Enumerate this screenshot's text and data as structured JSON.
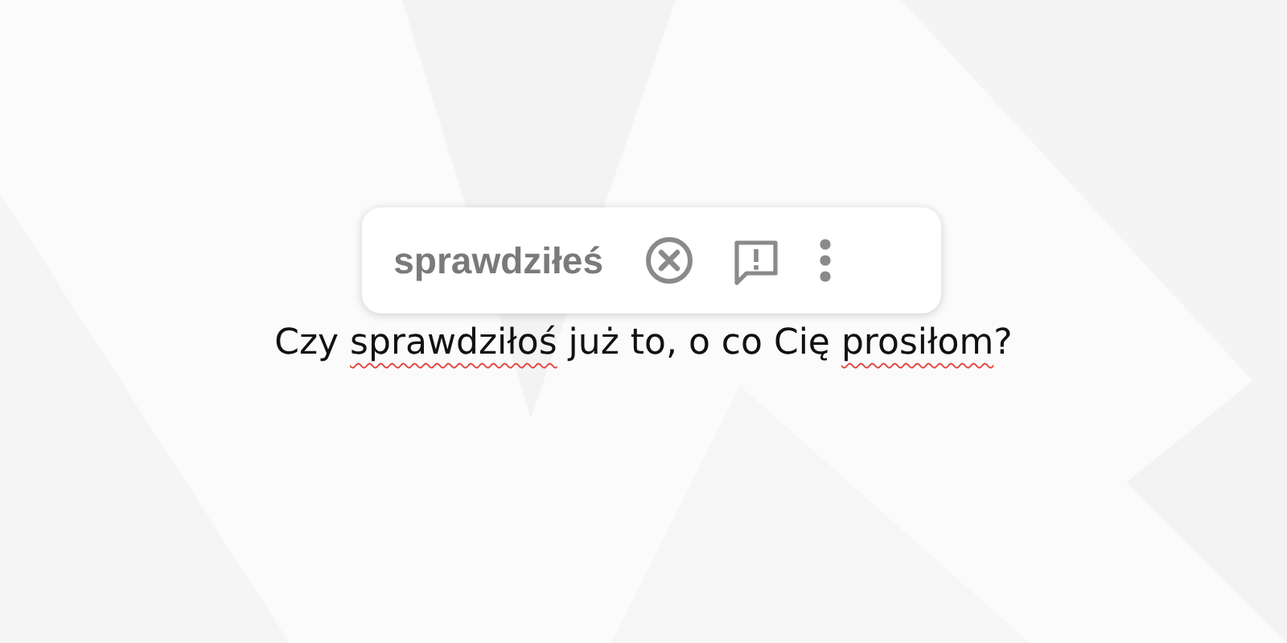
{
  "suggestion_popup": {
    "suggestion": "sprawdziłeś"
  },
  "sentence": [
    {
      "text": "Czy ",
      "misspelled": false
    },
    {
      "text": "sprawdziłoś",
      "misspelled": true
    },
    {
      "text": " już to, o co Cię ",
      "misspelled": false
    },
    {
      "text": "prosiłom",
      "misspelled": true
    },
    {
      "text": "?",
      "misspelled": false
    }
  ]
}
